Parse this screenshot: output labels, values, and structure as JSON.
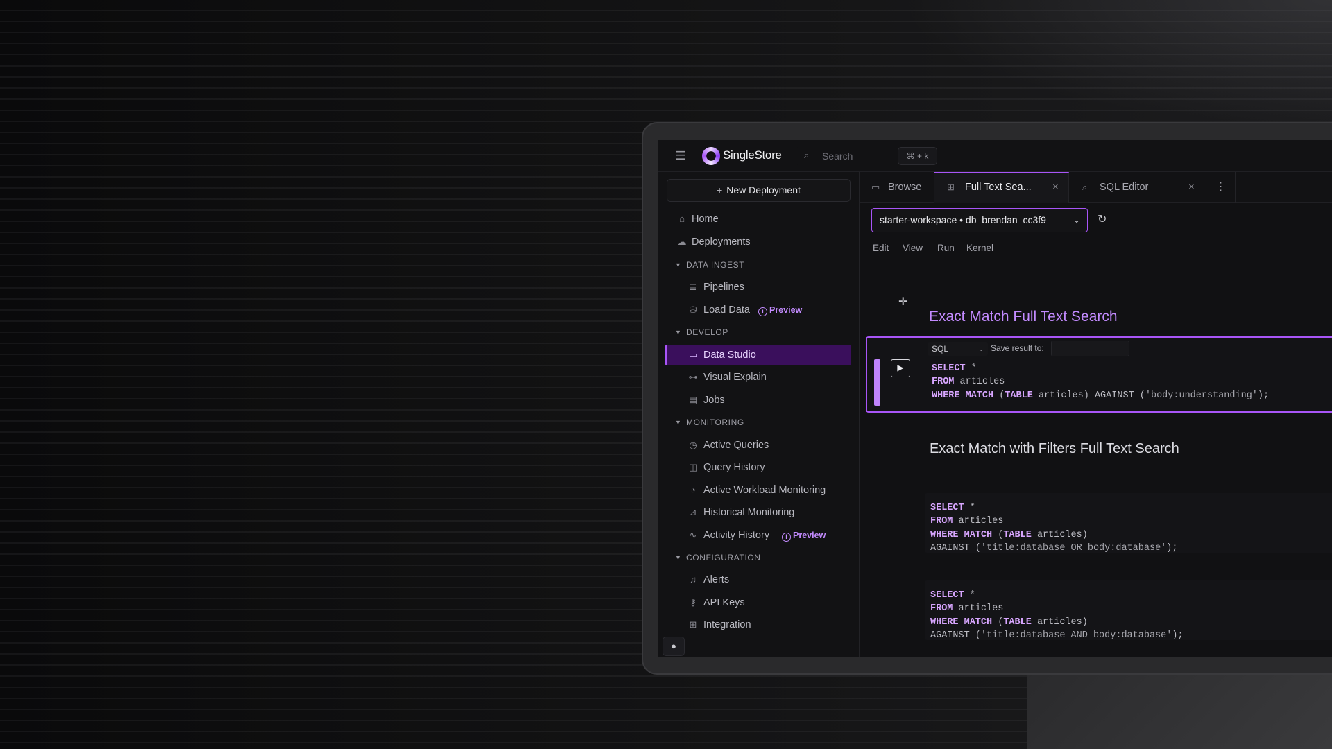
{
  "app": {
    "logo_text": "SingleStore",
    "search_placeholder": "Search",
    "search_shortcut": "⌘ + k"
  },
  "sidebar": {
    "new_deployment": "New Deployment",
    "items_top": [
      {
        "label": "Home",
        "icon": "home-icon"
      },
      {
        "label": "Deployments",
        "icon": "cloud-icon"
      }
    ],
    "sections": [
      {
        "title": "DATA INGEST",
        "items": [
          {
            "label": "Pipelines",
            "icon": "pipeline-icon"
          },
          {
            "label": "Load Data",
            "icon": "database-icon",
            "badge": "Preview"
          }
        ]
      },
      {
        "title": "DEVELOP",
        "items": [
          {
            "label": "Data Studio",
            "icon": "studio-icon",
            "active": true
          },
          {
            "label": "Visual Explain",
            "icon": "hierarchy-icon"
          },
          {
            "label": "Jobs",
            "icon": "calendar-icon"
          }
        ]
      },
      {
        "title": "MONITORING",
        "items": [
          {
            "label": "Active Queries",
            "icon": "clock-icon"
          },
          {
            "label": "Query History",
            "icon": "history-icon"
          },
          {
            "label": "Active Workload Monitoring",
            "icon": "workload-icon"
          },
          {
            "label": "Historical Monitoring",
            "icon": "chart-icon"
          },
          {
            "label": "Activity History",
            "icon": "activity-icon",
            "badge": "Preview"
          }
        ]
      },
      {
        "title": "CONFIGURATION",
        "items": [
          {
            "label": "Alerts",
            "icon": "bell-icon"
          },
          {
            "label": "API Keys",
            "icon": "key-icon"
          },
          {
            "label": "Integration",
            "icon": "grid-icon"
          }
        ]
      }
    ]
  },
  "tabs": [
    {
      "label": "Browse",
      "icon": "browse-icon",
      "closable": false
    },
    {
      "label": "Full Text Sea...",
      "icon": "notebook-icon",
      "closable": true,
      "active": true
    },
    {
      "label": "SQL Editor",
      "icon": "sql-editor-icon",
      "closable": true
    }
  ],
  "workspace": {
    "label": "starter-workspace  •  db_brendan_cc3f9"
  },
  "menu": [
    "Edit",
    "View",
    "Run",
    "Kernel"
  ],
  "notebook": {
    "heading1": "Exact Match Full Text Search",
    "cell1": {
      "language": "SQL",
      "save_label": "Save result to:",
      "lines": [
        [
          {
            "k": "SELECT"
          },
          {
            "t": " *"
          }
        ],
        [
          {
            "k": "FROM"
          },
          {
            "t": " articles"
          }
        ],
        [
          {
            "k": "WHERE MATCH"
          },
          {
            "t": " ("
          },
          {
            "k": "TABLE"
          },
          {
            "t": " articles) AGAINST ("
          },
          {
            "s": "'body:understanding'"
          },
          {
            "t": ");"
          }
        ]
      ]
    },
    "heading2": "Exact Match with Filters Full Text Search",
    "cell2": {
      "lines": [
        [
          {
            "k": "SELECT"
          },
          {
            "t": " *"
          }
        ],
        [
          {
            "k": "FROM"
          },
          {
            "t": " articles"
          }
        ],
        [
          {
            "k": "WHERE MATCH"
          },
          {
            "t": " ("
          },
          {
            "k": "TABLE"
          },
          {
            "t": " articles)"
          }
        ],
        [
          {
            "t": "AGAINST ("
          },
          {
            "s": "'title:database OR body:database'"
          },
          {
            "t": ");"
          }
        ]
      ]
    },
    "cell3": {
      "lines": [
        [
          {
            "k": "SELECT"
          },
          {
            "t": " *"
          }
        ],
        [
          {
            "k": "FROM"
          },
          {
            "t": " articles"
          }
        ],
        [
          {
            "k": "WHERE MATCH"
          },
          {
            "t": " ("
          },
          {
            "k": "TABLE"
          },
          {
            "t": " articles)"
          }
        ],
        [
          {
            "t": "AGAINST ("
          },
          {
            "s": "'title:database AND body:database'"
          },
          {
            "t": ");"
          }
        ]
      ]
    }
  },
  "colors": {
    "accent": "#a855f7",
    "heading_accent": "#c38bff",
    "active_nav_bg": "#3a0f5c"
  }
}
